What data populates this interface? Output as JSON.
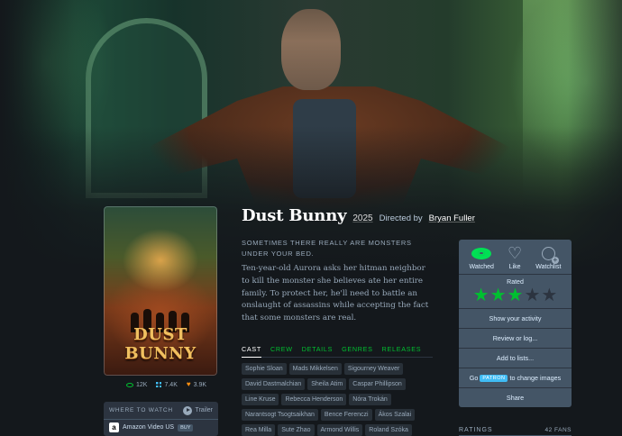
{
  "film": {
    "title": "Dust Bunny",
    "year": "2025",
    "directed_by": "Directed by",
    "director": "Bryan Fuller",
    "tagline": "SOMETIMES THERE REALLY ARE MONSTERS UNDER YOUR BED.",
    "synopsis": "Ten-year-old Aurora asks her hitman neighbor to kill the monster she believes ate her entire family. To protect her, he'll need to battle an onslaught of assassins while accepting the fact that some monsters are real.",
    "poster_title": "DUST BUNNY"
  },
  "stats": {
    "watched": "12K",
    "lists": "7.4K",
    "likes": "3.9K"
  },
  "where_to_watch": {
    "heading": "WHERE TO WATCH",
    "trailer": "Trailer",
    "service": "Amazon Video US",
    "buy": "BUY"
  },
  "tabs": [
    "CAST",
    "CREW",
    "DETAILS",
    "GENRES",
    "RELEASES"
  ],
  "cast": [
    "Sophie Sloan",
    "Mads Mikkelsen",
    "Sigourney Weaver",
    "David Dastmalchian",
    "Sheila Atim",
    "Caspar Phillipson",
    "Line Kruse",
    "Rebecca Henderson",
    "Nóra Trokán",
    "Narantsogt Tsogtsaikhan",
    "Bence Ferenczi",
    "Ákos Szalai",
    "Rea Milla",
    "Sute Zhao",
    "Armond Willis",
    "Roland Szóka"
  ],
  "actions": {
    "watched": "Watched",
    "like": "Like",
    "watchlist": "Watchlist",
    "rated": "Rated",
    "rating": 3,
    "rating_max": 5,
    "show_activity": "Show your activity",
    "review": "Review or log...",
    "add_lists": "Add to lists...",
    "go": "Go",
    "patron": "PATRON",
    "change_images": "to change images",
    "share": "Share"
  },
  "ratings": {
    "heading": "RATINGS",
    "fans": "42 FANS"
  },
  "colors": {
    "background": "#14181c",
    "accent_green": "#00c030",
    "panel": "#445566",
    "blue": "#40bcf4",
    "orange": "#ff9010"
  }
}
